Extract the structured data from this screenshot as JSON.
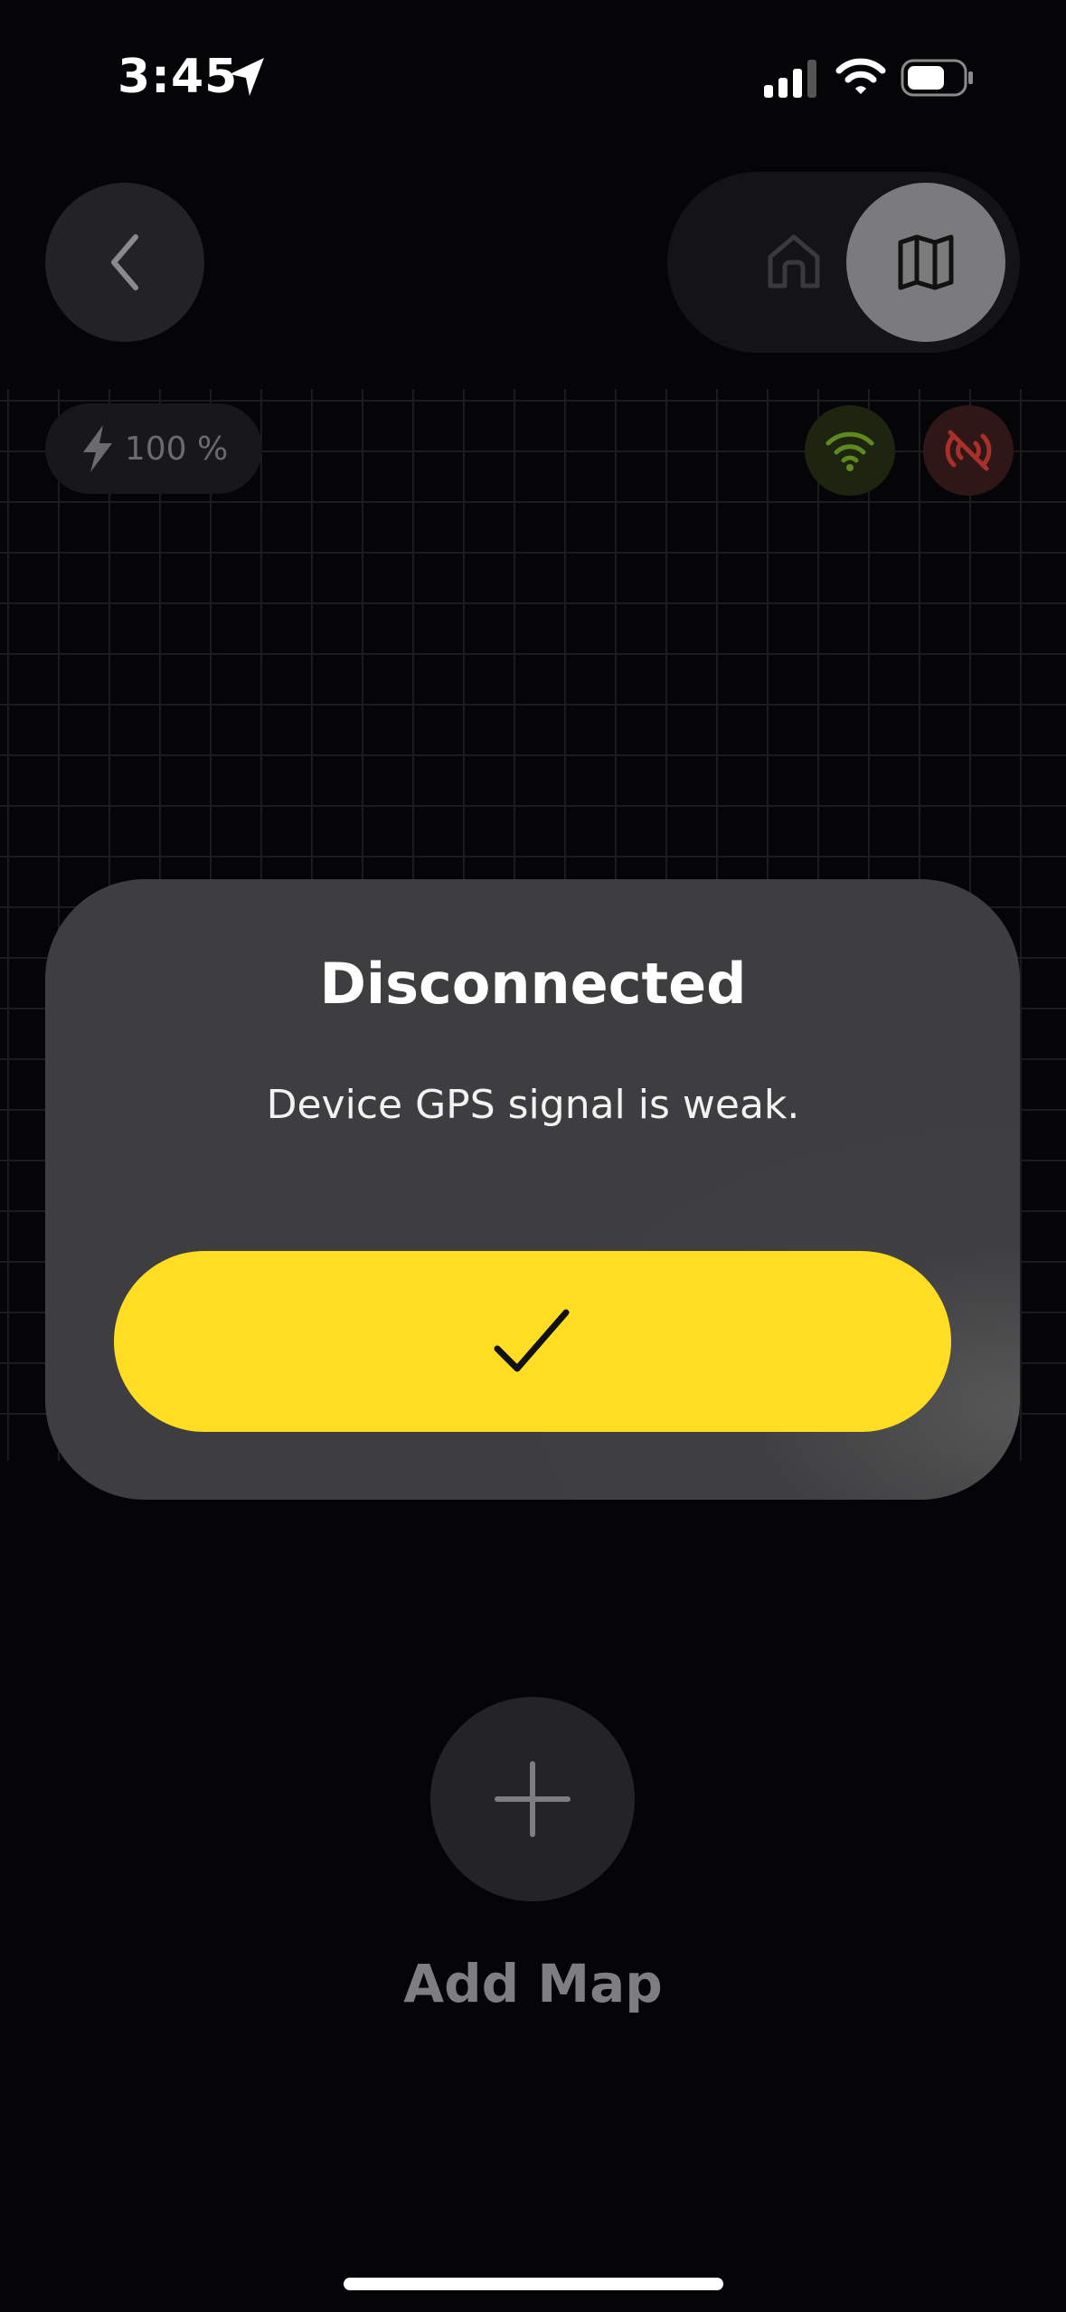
{
  "status_bar": {
    "time": "3:45",
    "icons": [
      "location-arrow-icon",
      "cellular-signal-icon",
      "wifi-icon",
      "battery-icon"
    ]
  },
  "header": {
    "back_icon": "chevron-left-icon",
    "segments": [
      {
        "icon": "home-icon",
        "selected": false
      },
      {
        "icon": "map-icon",
        "selected": true
      }
    ]
  },
  "map_panel": {
    "battery_text": "100 %",
    "battery_icon": "lightning-bolt-icon",
    "status_icons": [
      {
        "icon": "gps-wifi-icon",
        "color": "#5f8a1f"
      },
      {
        "icon": "signal-off-icon",
        "color": "#a8302a"
      }
    ]
  },
  "dialog": {
    "title": "Disconnected",
    "message": "Device GPS signal is weak.",
    "confirm_icon": "checkmark-icon",
    "confirm_color": "#fedd22"
  },
  "add_map": {
    "icon": "plus-icon",
    "label": "Add Map"
  }
}
